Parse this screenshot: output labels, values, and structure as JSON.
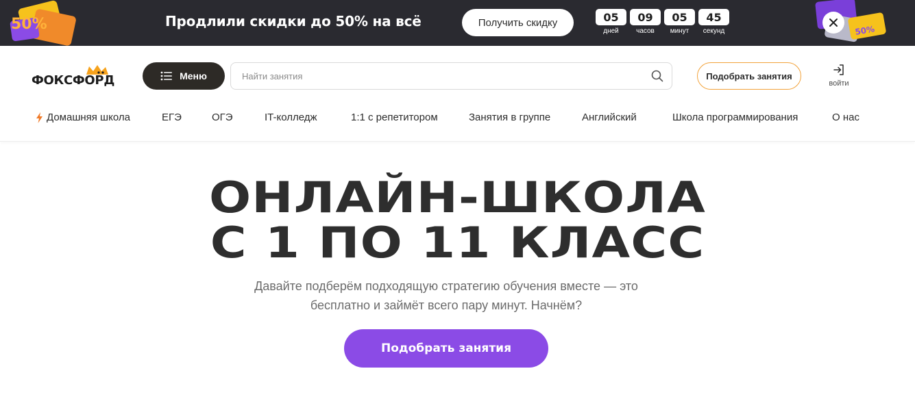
{
  "promo": {
    "title": "Продлили скидки до 50% на всё",
    "button_label": "Получить скидку",
    "timer": [
      {
        "value": "05",
        "unit": "дней"
      },
      {
        "value": "09",
        "unit": "часов"
      },
      {
        "value": "05",
        "unit": "минут"
      },
      {
        "value": "45",
        "unit": "секунд"
      }
    ],
    "badge_left": "50%",
    "badge_right": "50%"
  },
  "header": {
    "logo_text": "ФОКСФОРД",
    "menu_label": "Меню",
    "search_placeholder": "Найти занятия",
    "pick_label": "Подобрать занятия",
    "login_label": "войти"
  },
  "nav": {
    "items": [
      {
        "label": "Домашняя школа",
        "icon": "lightning-icon"
      },
      {
        "label": "ЕГЭ"
      },
      {
        "label": "ОГЭ"
      },
      {
        "label": "IT-колледж"
      },
      {
        "label": "1:1 с репетитором"
      },
      {
        "label": "Занятия в группе"
      },
      {
        "label": "Английский"
      },
      {
        "label": "Школа программирования"
      },
      {
        "label": "О нас"
      }
    ]
  },
  "hero": {
    "title_line1": "ОНЛАЙН-ШКОЛА",
    "title_line2": "С 1 ПО 11 КЛАСС",
    "subtitle_line1": "Давайте подберём подходящую стратегию обучения вместе — это",
    "subtitle_line2": "бесплатно и займёт всего пару минут. Начнём?",
    "button_label": "Подобрать занятия"
  },
  "colors": {
    "promo_bg": "#2a2a30",
    "accent_orange": "#f2a23a",
    "accent_purple": "#8b4be6",
    "menu_btn_bg": "#2d2a26"
  }
}
